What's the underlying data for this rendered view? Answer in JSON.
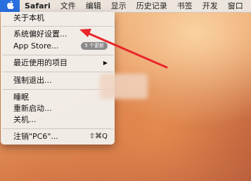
{
  "menubar": {
    "app_name": "Safari",
    "items": [
      "文件",
      "编辑",
      "显示",
      "历史记录",
      "书签",
      "开发",
      "窗口"
    ]
  },
  "apple_menu": {
    "about": "关于本机",
    "system_prefs": "系统偏好设置...",
    "app_store": "App Store...",
    "app_store_badge": "5 个更新",
    "recent_items": "最近使用的项目",
    "force_quit": "强制退出...",
    "sleep": "睡眠",
    "restart": "重新启动...",
    "shutdown": "关机...",
    "logout": "注销\"PC6\"...",
    "logout_shortcut": "⇧⌘Q"
  },
  "annotation": {
    "arrow_color": "#e8262a"
  }
}
